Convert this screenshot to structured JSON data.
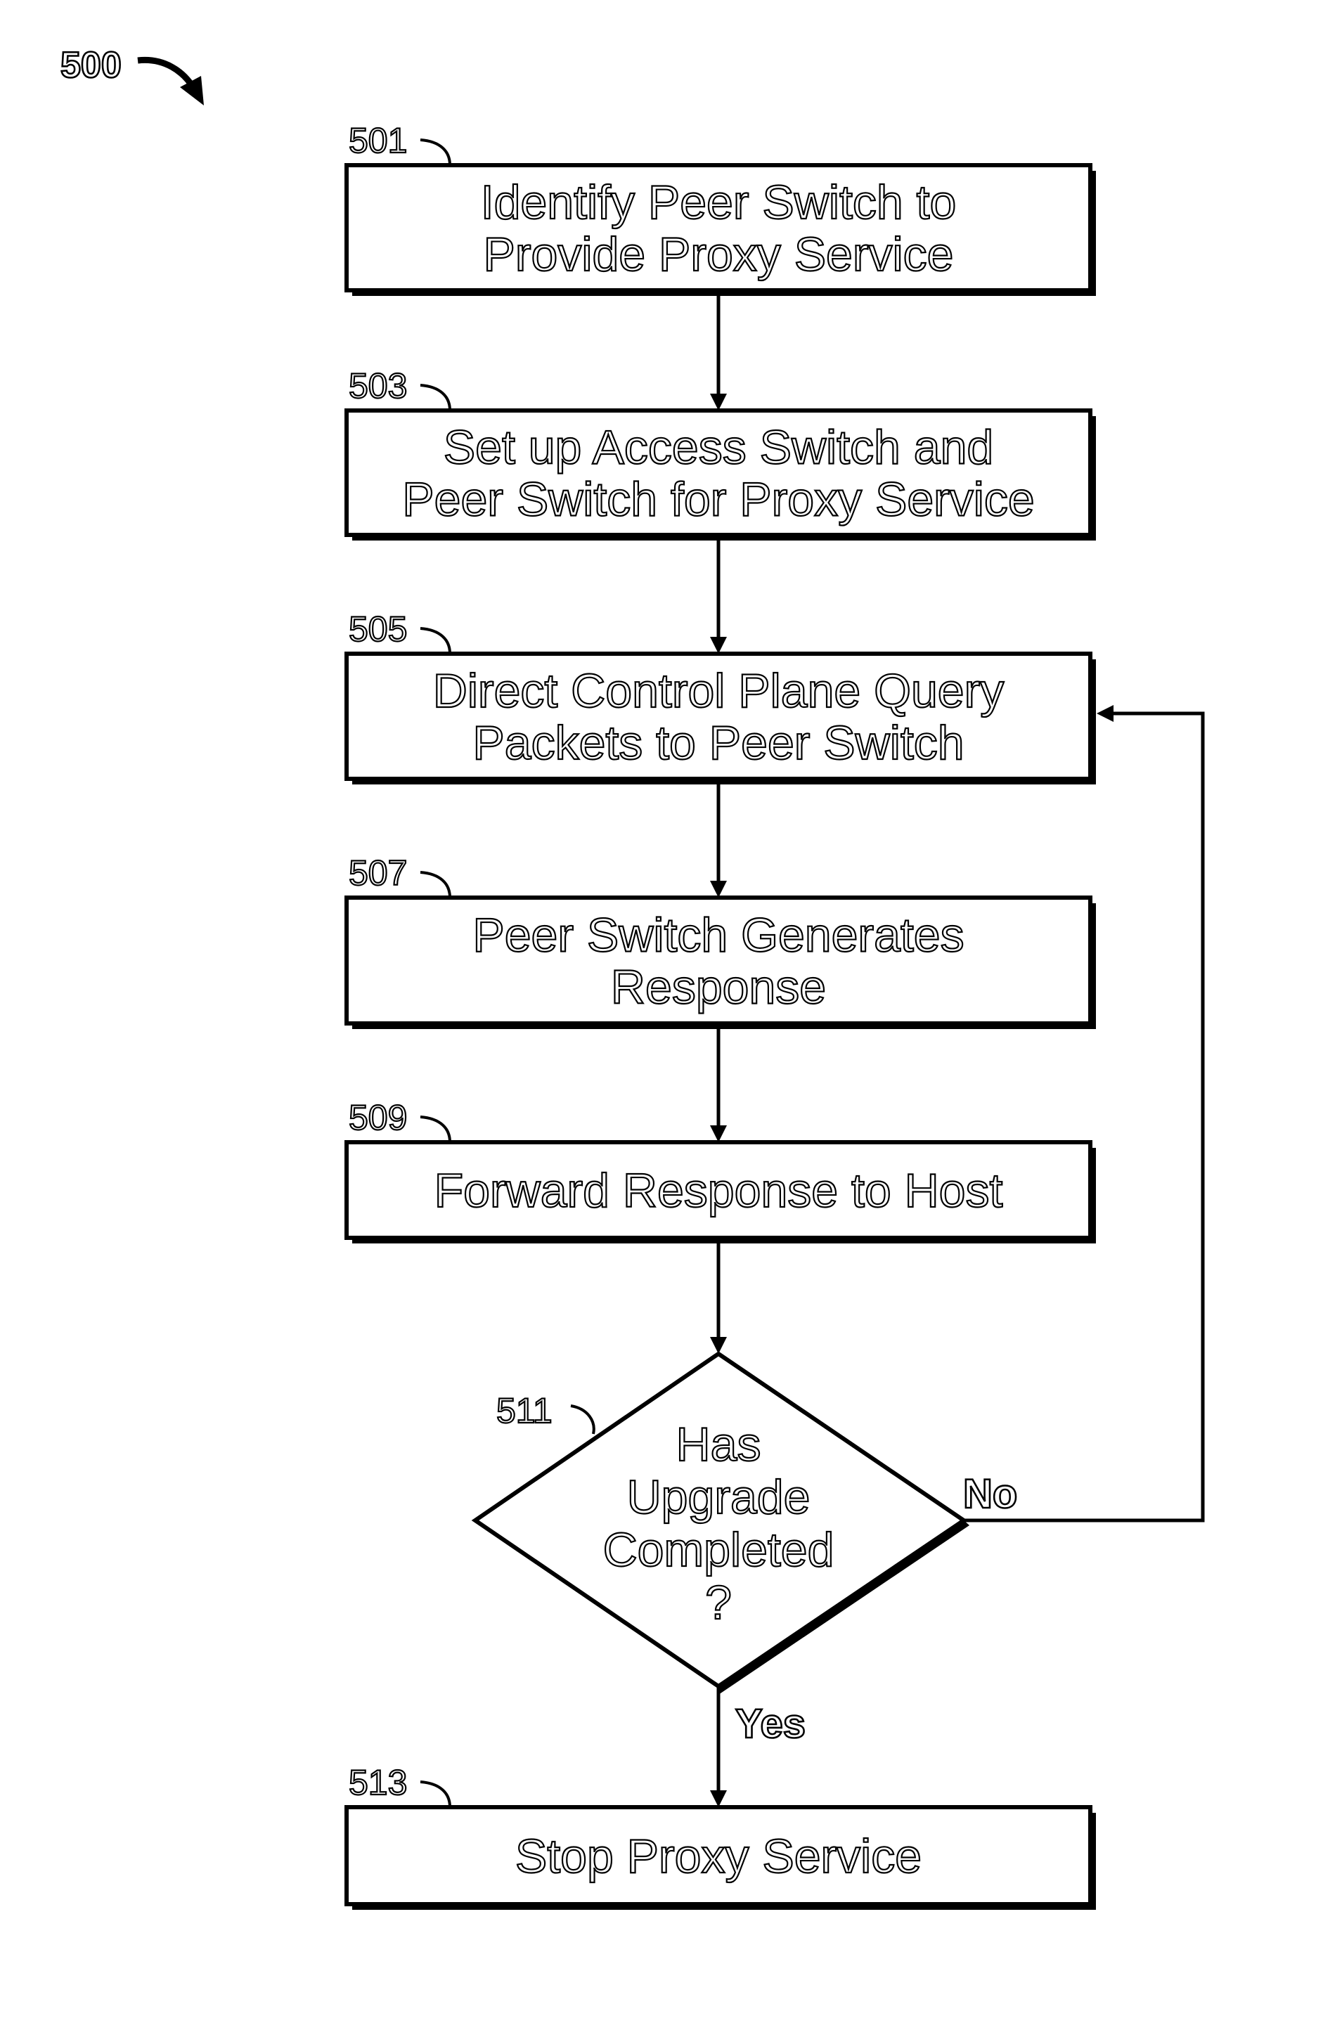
{
  "figure": {
    "number": "500"
  },
  "steps": [
    {
      "ref": "501",
      "lines": [
        "Identify Peer Switch to",
        "Provide Proxy Service"
      ]
    },
    {
      "ref": "503",
      "lines": [
        "Set up Access Switch and",
        "Peer Switch for Proxy Service"
      ]
    },
    {
      "ref": "505",
      "lines": [
        "Direct Control Plane Query",
        "Packets to Peer Switch"
      ]
    },
    {
      "ref": "507",
      "lines": [
        "Peer Switch Generates",
        "Response"
      ]
    },
    {
      "ref": "509",
      "lines": [
        "Forward Response to Host"
      ]
    }
  ],
  "decision": {
    "ref": "511",
    "lines": [
      "Has",
      "Upgrade",
      "Completed",
      "?"
    ],
    "no_label": "No",
    "yes_label": "Yes"
  },
  "final_step": {
    "ref": "513",
    "lines": [
      "Stop Proxy Service"
    ]
  },
  "colors": {
    "ink": "#000000",
    "background": "#ffffff"
  }
}
